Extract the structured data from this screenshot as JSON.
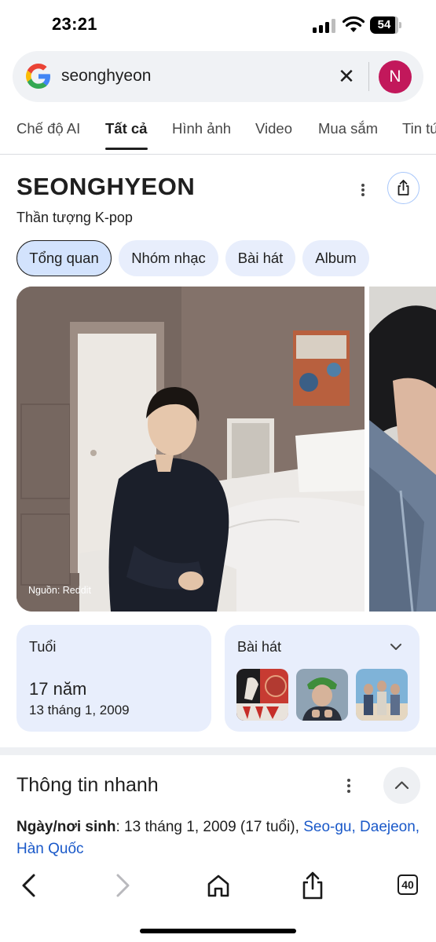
{
  "status_bar": {
    "time": "23:21",
    "battery_level": "54",
    "icons": [
      "cellular-signal-icon",
      "wifi-icon",
      "battery-icon"
    ]
  },
  "search": {
    "query": "seonghyeon",
    "logo_icon": "google-g-icon",
    "clear_icon": "close-icon",
    "account_initial": "N",
    "account_color": "#c2185b"
  },
  "tabs": [
    {
      "label": "Chế độ AI",
      "active": false
    },
    {
      "label": "Tất cả",
      "active": true
    },
    {
      "label": "Hình ảnh",
      "active": false
    },
    {
      "label": "Video",
      "active": false
    },
    {
      "label": "Mua sắm",
      "active": false
    },
    {
      "label": "Tin tứ",
      "active": false
    }
  ],
  "entity": {
    "title": "SEONGHYEON",
    "subtitle": "Thần tượng K-pop",
    "chips": [
      {
        "label": "Tổng quan",
        "active": true
      },
      {
        "label": "Nhóm nhạc",
        "active": false
      },
      {
        "label": "Bài hát",
        "active": false
      },
      {
        "label": "Album",
        "active": false
      }
    ],
    "image_source": "Nguồn: Reddit",
    "age_card": {
      "label": "Tuổi",
      "value": "17 năm",
      "date": "13 tháng 1, 2009"
    },
    "songs_card": {
      "label": "Bài hát",
      "thumbnails": [
        "song-cover-1",
        "song-cover-2",
        "song-cover-3"
      ]
    }
  },
  "quick_facts": {
    "title": "Thông tin nhanh",
    "birth_label": "Ngày/nơi sinh",
    "birth_text": ": 13 tháng 1, 2009 (17 tuổi), ",
    "birth_place": "Seo-gu, Daejeon, Hàn Quốc"
  },
  "toolbar": {
    "tab_count": "40",
    "icons": [
      "back-icon",
      "forward-icon",
      "home-icon",
      "share-icon",
      "tabs-icon"
    ]
  },
  "colors": {
    "accent_blue": "#1a59c9",
    "chip_bg": "#e8eefc",
    "chip_active_bg": "#d3e3fd",
    "avatar": "#c2185b"
  }
}
